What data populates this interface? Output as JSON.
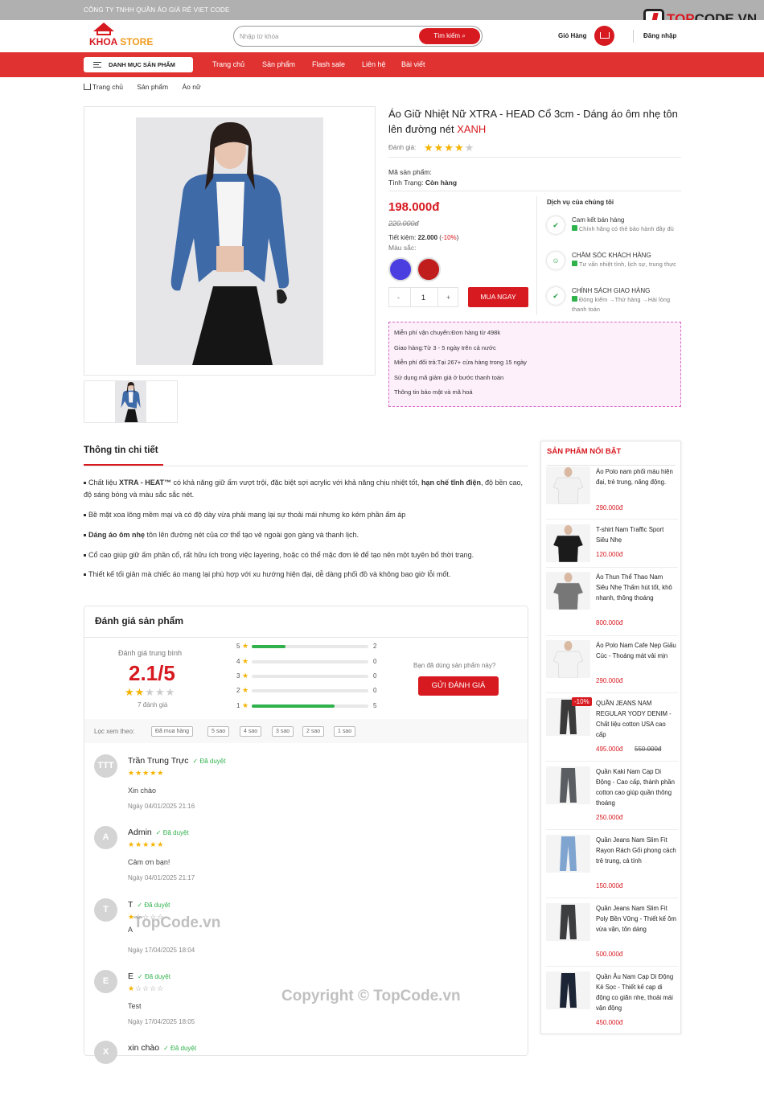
{
  "topbar": {
    "company": "CÔNG TY TNHH QUẦN ÁO GIÁ RẺ VIET CODE"
  },
  "topcode_logo": {
    "prefix": "T",
    "highlight": "OP",
    "suffix": "CODE.VN"
  },
  "header": {
    "logo_khoa": "KHOA",
    "logo_store": "STORE",
    "search_placeholder": "Nhập từ khóa",
    "search_button": "Tìm kiếm",
    "cart_label": "Giỏ Hàng",
    "login_label": "Đăng nhập"
  },
  "nav": {
    "category_button": "DANH MỤC SẢN PHẨM",
    "links": [
      "Trang chủ",
      "Sản phẩm",
      "Flash sale",
      "Liên hệ",
      "Bài viết"
    ]
  },
  "breadcrumb": [
    "Trang chủ",
    "Sản phẩm",
    "Áo nữ"
  ],
  "product": {
    "title": "Áo Giữ Nhiệt Nữ XTRA - HEAD Cổ 3cm - Dáng áo ôm nhẹ tôn lên đường nét",
    "title_highlight": "XANH",
    "rating_label": "Đánh giá:",
    "rating_stars": 4,
    "sku_label": "Mã sản phẩm:",
    "status_label": "Tình Trạng:",
    "status_value": "Còn hàng",
    "price": "198.000đ",
    "old_price": "220.000đ",
    "saving_label": "Tiết kiệm:",
    "saving_value": "22.000",
    "saving_pct": "-10%",
    "color_label": "Màu sắc:",
    "colors": [
      "#4a3ee0",
      "#c01d1d"
    ],
    "qty_minus": "-",
    "qty": "1",
    "qty_plus": "+",
    "buy_button": "MUA NGAY"
  },
  "services": {
    "title": "Dịch vụ của chúng tôi",
    "items": [
      {
        "icon": "check-icon",
        "title": "Cam kết bán hàng",
        "desc": "Chính hãng có thẻ bảo hành đầy đủ"
      },
      {
        "icon": "smile-icon",
        "title": "CHĂM SÓC KHÁCH HÀNG",
        "desc": "Tư vấn nhiệt tình, lịch sự, trung thực"
      },
      {
        "icon": "check-icon",
        "title": "CHÍNH SÁCH GIAO HÀNG",
        "desc": "Đóng kiểm →Thử hàng →Hài lòng thanh toán"
      }
    ]
  },
  "promo": [
    "Miễn phí vận chuyển:Đơn hàng từ 498k",
    "Giao hàng:Từ 3 - 5 ngày trên cả nước",
    "Miễn phí đổi trả:Tại 267+ cửa hàng trong 15 ngày",
    "Sử dụng mã giảm giá ở bước thanh toán",
    "Thông tin bảo mật và mã hoá"
  ],
  "details": {
    "tab": "Thông tin chi tiết",
    "b1_a": "Chất liệu ",
    "b1_b": "XTRA - HEAT™",
    "b1_c": " có khả năng giữ ấm vượt trội, đặc biệt sợi acrylic với khả năng chịu nhiệt tốt, ",
    "b1_d": "hạn chế tĩnh điện",
    "b1_e": ", độ bền cao, độ sáng bóng và màu sắc sắc nét.",
    "b2": "Bề mặt xoa lông mềm mại và có độ dày vừa phải mang lại sự thoải mái nhưng ko kém phần ấm áp",
    "b3_a": "Dáng áo ôm nhẹ",
    "b3_b": " tôn lên đường nét của cơ thể tạo vẻ ngoài gọn gàng và thanh lịch.",
    "b4": "Cổ cao giúp giữ ấm phần cổ, rất hữu ích trong việc layering, hoặc có thể mặc đơn lẻ để tạo nên một tuyên bố thời trang.",
    "b5": "Thiết kế tối giản mà chiếc áo mang lại phù hợp với xu hướng hiện đại, dễ dàng phối đồ và không bao giờ lỗi mốt."
  },
  "reviews": {
    "title": "Đánh giá sản phẩm",
    "avg_label": "Đánh giá trung bình",
    "avg": "2.1/5",
    "avg_stars": 2,
    "count": "7 đánh giá",
    "bars": [
      {
        "star": "5",
        "count": "2",
        "fill": 0.29
      },
      {
        "star": "4",
        "count": "0",
        "fill": 0
      },
      {
        "star": "3",
        "count": "0",
        "fill": 0
      },
      {
        "star": "2",
        "count": "0",
        "fill": 0
      },
      {
        "star": "1",
        "count": "5",
        "fill": 0.71
      }
    ],
    "ask": "Bạn đã dùng sản phẩm này?",
    "send_button": "GỬI ĐÁNH GIÁ",
    "filter_label": "Lọc xem theo:",
    "filters": [
      "Đã mua hàng",
      "5 sao",
      "4 sao",
      "3 sao",
      "2 sao",
      "1 sao"
    ],
    "approved": "Đã duyệt",
    "comments": [
      {
        "avatar": "TTT",
        "name": "Trần Trung Trực",
        "stars": 5,
        "text": "Xin chào",
        "date": "Ngày 04/01/2025 21:16"
      },
      {
        "avatar": "A",
        "name": "Admin",
        "stars": 5,
        "text": "Cảm ơn bạn!",
        "date": "Ngày 04/01/2025 21:17"
      },
      {
        "avatar": "T",
        "name": "T",
        "stars": 1,
        "text": "A",
        "date": "Ngày 17/04/2025 18:04"
      },
      {
        "avatar": "E",
        "name": "E",
        "stars": 1,
        "text": "Test",
        "date": "Ngày 17/04/2025 18:05"
      },
      {
        "avatar": "X",
        "name": "xin chào",
        "stars": 0,
        "text": "",
        "date": ""
      }
    ]
  },
  "sidebar": {
    "title": "SẢN PHẨM NỔI BẬT",
    "items": [
      {
        "name": "Áo Polo nam phối màu hiện đại, trẻ trung, năng động.",
        "price": "290.000đ",
        "color": "#f1f1f1"
      },
      {
        "name": "T-shirt Nam Traffic Sport Siêu Nhẹ",
        "price": "120.000đ",
        "color": "#1b1b1b"
      },
      {
        "name": "Áo Thun Thể Thao Nam Siêu Nhẹ Thấm hút tốt, khô nhanh, thông thoáng",
        "price": "800.000đ",
        "color": "#777"
      },
      {
        "name": "Áo Polo Nam Cafe Nẹp Giấu Cúc - Thoáng mát vải mịn",
        "price": "290.000đ",
        "color": "#f3f3f3"
      },
      {
        "name": "QUẦN JEANS NAM REGULAR YODY DENIM - Chất liệu cotton USA cao cấp",
        "price": "495.000đ",
        "old_price": "550.000đ",
        "discount": "-10%",
        "color": "#3a3a3a"
      },
      {
        "name": "Quần Kaki Nam Cạp Di Động - Cao cấp, thành phần cotton cao giúp quần thông thoáng",
        "price": "250.000đ",
        "color": "#5a5d61"
      },
      {
        "name": "Quần Jeans Nam Slim Fit Rayon Rách Gối phong cách trẻ trung, cá tính",
        "price": "150.000đ",
        "color": "#7ea4cf"
      },
      {
        "name": "Quần Jeans Nam Slim Fit Poly Bền Vững - Thiết kế ôm vừa vặn, tôn dáng",
        "price": "500.000đ",
        "color": "#3b3d3f"
      },
      {
        "name": "Quần Âu Nam Cạp Di Động Kẻ Sọc - Thiết kế cạp di động co giãn nhẹ, thoải mái vận động",
        "price": "450.000đ",
        "color": "#1c2536"
      }
    ]
  },
  "watermarks": {
    "a": "TopCode.vn",
    "b": "Copyright © TopCode.vn"
  }
}
